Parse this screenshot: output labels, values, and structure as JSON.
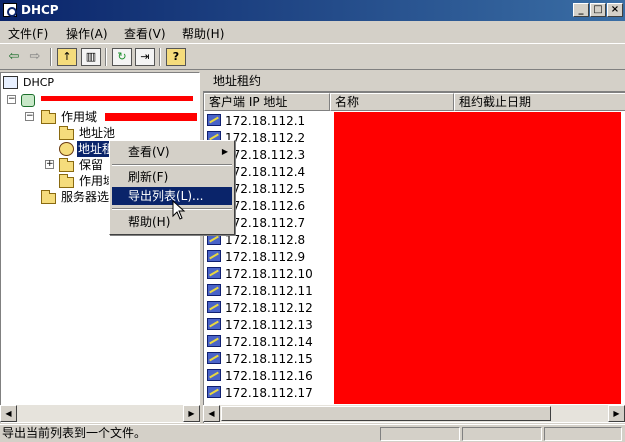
{
  "window": {
    "title": "DHCP",
    "controls": [
      "_",
      "□",
      "×"
    ]
  },
  "menubar": [
    {
      "label": "文件(F)"
    },
    {
      "label": "操作(A)"
    },
    {
      "label": "查看(V)"
    },
    {
      "label": "帮助(H)"
    }
  ],
  "toolbar": {
    "buttons": [
      "back-arrow",
      "forward-arrow",
      "up-folder",
      "show-hide-tree",
      "refresh",
      "export-list",
      "help"
    ]
  },
  "tree": {
    "root": "DHCP",
    "scope": "作用域",
    "address_pool": "地址池",
    "address_leases": "地址租",
    "reservations": "保留",
    "scope_options": "作用域",
    "server_options": "服务器选"
  },
  "right_pane": {
    "title": "地址租约",
    "columns": [
      "客户端 IP 地址",
      "名称",
      "租约截止日期"
    ],
    "rows": [
      "172.18.112.1",
      "172.18.112.2",
      "172.18.112.3",
      "172.18.112.4",
      "172.18.112.5",
      "172.18.112.6",
      "172.18.112.7",
      "172.18.112.8",
      "172.18.112.9",
      "172.18.112.10",
      "172.18.112.11",
      "172.18.112.12",
      "172.18.112.13",
      "172.18.112.14",
      "172.18.112.15",
      "172.18.112.16",
      "172.18.112.17"
    ]
  },
  "context_menu": {
    "view": "查看(V)",
    "refresh": "刷新(F)",
    "export": "导出列表(L)...",
    "help": "帮助(H)"
  },
  "status_bar": {
    "text": "导出当前列表到一个文件。"
  },
  "colors": {
    "title_start": "#0a246a",
    "title_end": "#3a6ea5",
    "selection": "#0a246a",
    "redaction": "#ff0000",
    "face": "#d4d0c8"
  }
}
